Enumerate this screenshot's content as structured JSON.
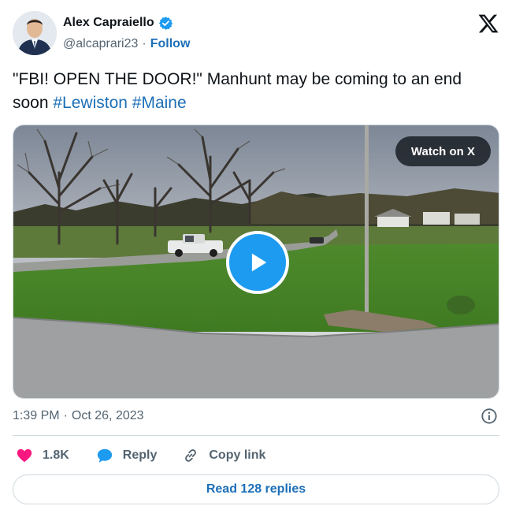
{
  "author": {
    "name": "Alex Capraiello",
    "handle": "@alcaprari23",
    "separator": "·",
    "follow_label": "Follow",
    "verified": true
  },
  "tweet": {
    "text_main": "\"FBI! OPEN THE DOOR!\" Manhunt may be coming to an end soon ",
    "hashtags": [
      "#Lewiston",
      "#Maine"
    ]
  },
  "media": {
    "watch_label": "Watch on X",
    "play_icon": "play-icon"
  },
  "meta": {
    "time": "1:39 PM",
    "separator": "·",
    "date": "Oct 26, 2023"
  },
  "actions": {
    "like_count": "1.8K",
    "reply_label": "Reply",
    "copy_link_label": "Copy link"
  },
  "read_replies_label": "Read 128 replies",
  "colors": {
    "link": "#1d6fb8",
    "play": "#1d9bf0",
    "heart": "#f91880",
    "reply_bubble": "#1d9bf0",
    "muted": "#536471"
  }
}
